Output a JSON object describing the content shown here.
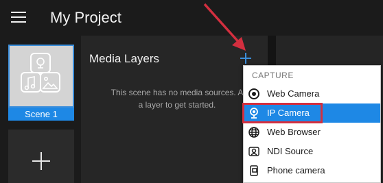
{
  "header": {
    "title": "My Project"
  },
  "scenes": {
    "items": [
      {
        "label": "Scene 1"
      }
    ]
  },
  "media": {
    "title": "Media Layers",
    "empty_message": "This scene has no media sources. Add a layer to get started.",
    "empty_line1": "This scene has no media sources. A",
    "empty_line2": "a layer to get started."
  },
  "menu": {
    "header": "CAPTURE",
    "items": [
      {
        "label": "Web Camera",
        "icon": "webcam-icon"
      },
      {
        "label": "IP Camera",
        "icon": "ip-camera-icon",
        "selected": true
      },
      {
        "label": "Web Browser",
        "icon": "globe-icon"
      },
      {
        "label": "NDI Source",
        "icon": "ndi-icon"
      },
      {
        "label": "Phone camera",
        "icon": "phone-camera-icon"
      }
    ]
  },
  "colors": {
    "accent": "#1e88e5",
    "annotation": "#d32f3f",
    "background": "#1f1f1f"
  }
}
